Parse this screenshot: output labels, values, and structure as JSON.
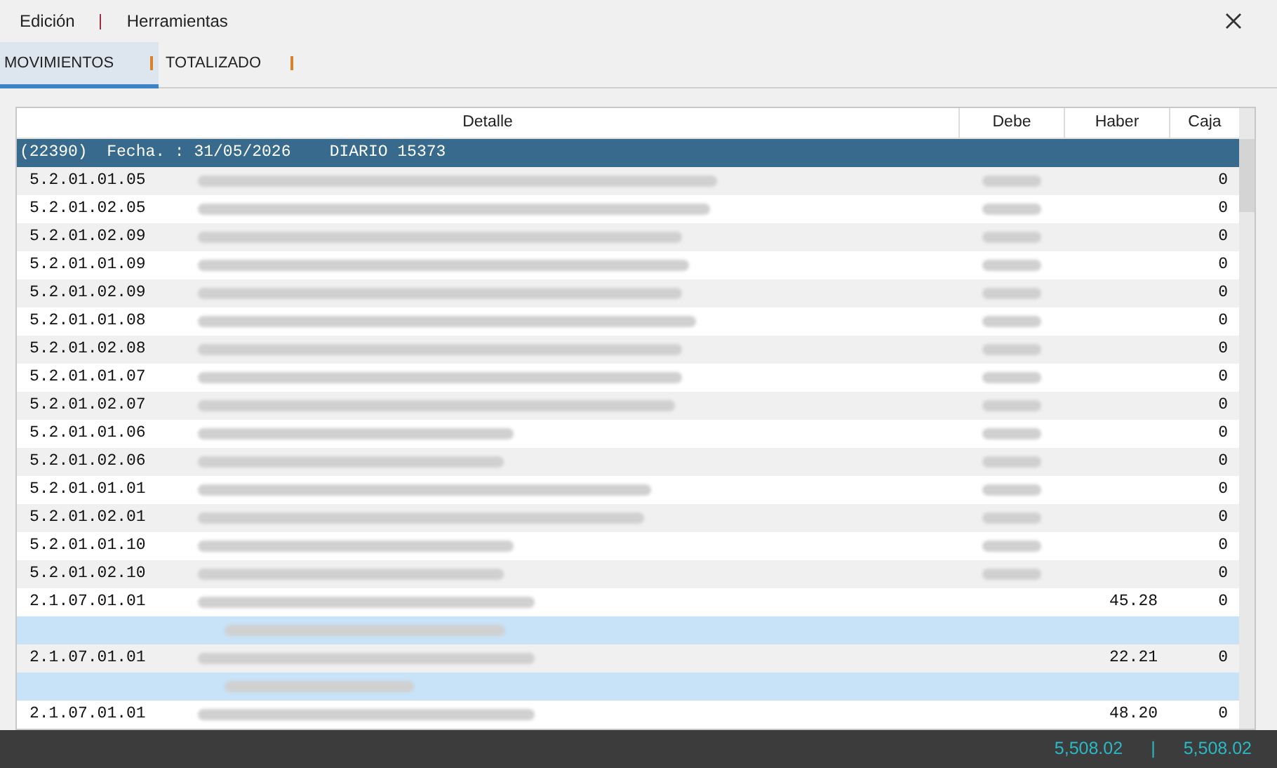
{
  "menu": [
    "Edición",
    "Herramientas"
  ],
  "tabs": [
    {
      "label": "MOVIMIENTOS",
      "selected": true
    },
    {
      "label": "TOTALIZADO",
      "selected": false
    }
  ],
  "table": {
    "columns": [
      "Detalle",
      "Debe",
      "Haber",
      "Caja"
    ],
    "group": "(22390)  Fecha. : 31/05/2026    DIARIO 15373",
    "rows": [
      {
        "kind": "line",
        "account": "5.2.01.01.05",
        "detail_redacted": true,
        "debe_redacted": true,
        "caja": "0"
      },
      {
        "kind": "line",
        "account": "5.2.01.02.05",
        "detail_redacted": true,
        "debe_redacted": true,
        "caja": "0"
      },
      {
        "kind": "line",
        "account": "5.2.01.02.09",
        "detail_redacted": true,
        "debe_redacted": true,
        "caja": "0"
      },
      {
        "kind": "line",
        "account": "5.2.01.01.09",
        "detail_redacted": true,
        "debe_redacted": true,
        "caja": "0"
      },
      {
        "kind": "line",
        "account": "5.2.01.02.09",
        "detail_redacted": true,
        "debe_redacted": true,
        "caja": "0"
      },
      {
        "kind": "line",
        "account": "5.2.01.01.08",
        "detail_redacted": true,
        "debe_redacted": true,
        "caja": "0"
      },
      {
        "kind": "line",
        "account": "5.2.01.02.08",
        "detail_redacted": true,
        "debe_redacted": true,
        "caja": "0"
      },
      {
        "kind": "line",
        "account": "5.2.01.01.07",
        "detail_redacted": true,
        "debe_redacted": true,
        "caja": "0"
      },
      {
        "kind": "line",
        "account": "5.2.01.02.07",
        "detail_redacted": true,
        "debe_redacted": true,
        "caja": "0"
      },
      {
        "kind": "line",
        "account": "5.2.01.01.06",
        "detail_redacted": true,
        "debe_redacted": true,
        "caja": "0"
      },
      {
        "kind": "line",
        "account": "5.2.01.02.06",
        "detail_redacted": true,
        "debe_redacted": true,
        "caja": "0"
      },
      {
        "kind": "line",
        "account": "5.2.01.01.01",
        "detail_redacted": true,
        "debe_redacted": true,
        "caja": "0"
      },
      {
        "kind": "line",
        "account": "5.2.01.02.01",
        "detail_redacted": true,
        "debe_redacted": true,
        "caja": "0"
      },
      {
        "kind": "line",
        "account": "5.2.01.01.10",
        "detail_redacted": true,
        "debe_redacted": true,
        "caja": "0"
      },
      {
        "kind": "line",
        "account": "5.2.01.02.10",
        "detail_redacted": true,
        "debe_redacted": true,
        "caja": "0"
      },
      {
        "kind": "line",
        "account": "2.1.07.01.01",
        "detail_redacted": true,
        "haber": "45.28",
        "caja": "0"
      },
      {
        "kind": "sub",
        "detail_redacted": true
      },
      {
        "kind": "line",
        "account": "2.1.07.01.01",
        "detail_redacted": true,
        "haber": "22.21",
        "caja": "0"
      },
      {
        "kind": "sub",
        "detail_redacted": true
      },
      {
        "kind": "line",
        "account": "2.1.07.01.01",
        "detail_redacted": true,
        "haber": "48.20",
        "caja": "0"
      }
    ]
  },
  "totals": {
    "debe": "5,508.02",
    "separator": "|",
    "haber": "5,508.02"
  }
}
